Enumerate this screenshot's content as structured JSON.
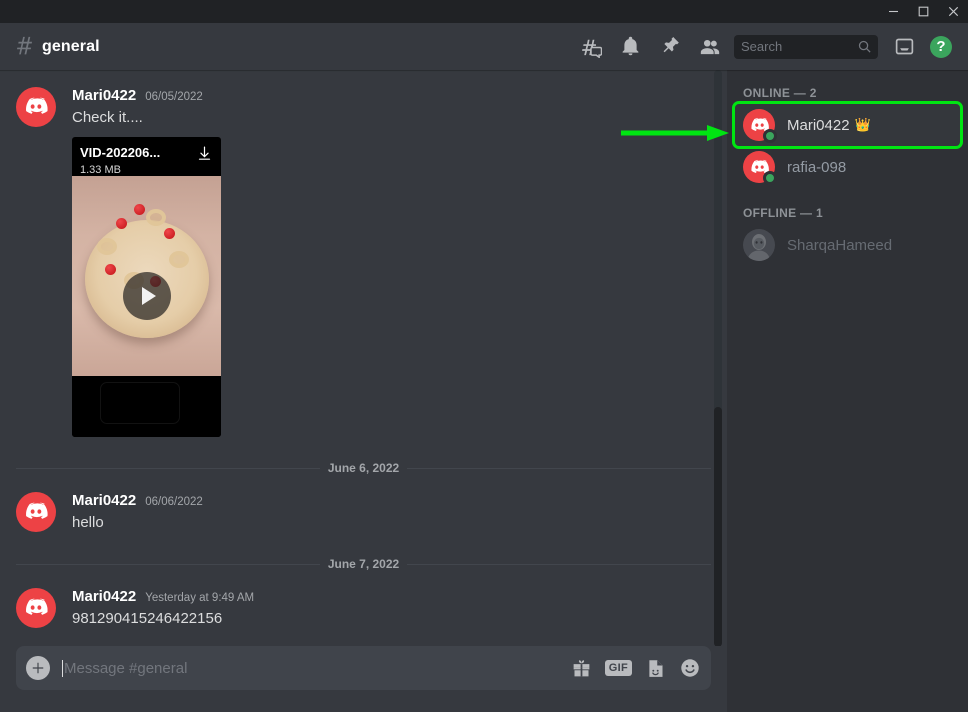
{
  "window": {
    "minimize_label": "Minimize",
    "maximize_label": "Maximize",
    "close_label": "Close"
  },
  "header": {
    "hash": "#",
    "channel_name": "general",
    "icons": [
      "threads-icon",
      "bell-icon",
      "pin-icon",
      "members-icon"
    ],
    "search_placeholder": "Search",
    "help_label": "?"
  },
  "messages": [
    {
      "author": "Mari0422",
      "timestamp": "06/05/2022",
      "text": "Check it....",
      "attachment": {
        "filename": "VID-202206...",
        "size": "1.33 MB",
        "download_label": "Download"
      }
    },
    {
      "divider": "June 6, 2022"
    },
    {
      "author": "Mari0422",
      "timestamp": "06/06/2022",
      "text": "hello"
    },
    {
      "divider": "June 7, 2022"
    },
    {
      "author": "Mari0422",
      "timestamp": "Yesterday at 9:49 AM",
      "text": "981290415246422156"
    }
  ],
  "msg0": {
    "author": "Mari0422",
    "timestamp": "06/05/2022",
    "text": "Check it....",
    "file_name": "VID-202206...",
    "file_size": "1.33 MB"
  },
  "div0": {
    "label": "June 6, 2022"
  },
  "msg1": {
    "author": "Mari0422",
    "timestamp": "06/06/2022",
    "text": "hello"
  },
  "div1": {
    "label": "June 7, 2022"
  },
  "msg2": {
    "author": "Mari0422",
    "timestamp": "Yesterday at 9:49 AM",
    "text": "981290415246422156"
  },
  "composer": {
    "placeholder": "Message #general",
    "plus_label": "+",
    "gif_label": "GIF",
    "icons": [
      "gift-icon",
      "gif-icon",
      "sticker-icon",
      "emoji-icon"
    ]
  },
  "members": {
    "online_title": "ONLINE — 2",
    "offline_title": "OFFLINE — 1",
    "online": [
      {
        "name": "Mari0422",
        "crown": "👑",
        "status": "online",
        "highlighted": true
      },
      {
        "name": "rafia-098",
        "crown": "",
        "status": "online",
        "highlighted": false
      }
    ],
    "offline": [
      {
        "name": "SharqaHameed",
        "status": "offline"
      }
    ]
  },
  "member0": {
    "name": "Mari0422",
    "crown": "👑"
  },
  "member1": {
    "name": "rafia-098"
  },
  "member2": {
    "name": "SharqaHameed"
  },
  "colors": {
    "accent_green": "#00e512",
    "online_green": "#3ba55d",
    "avatar_red": "#ed4245",
    "chat_bg": "#36393f",
    "sidebar_bg": "#2f3136",
    "titlebar_bg": "#202225",
    "crown_gold": "#f0b232"
  }
}
